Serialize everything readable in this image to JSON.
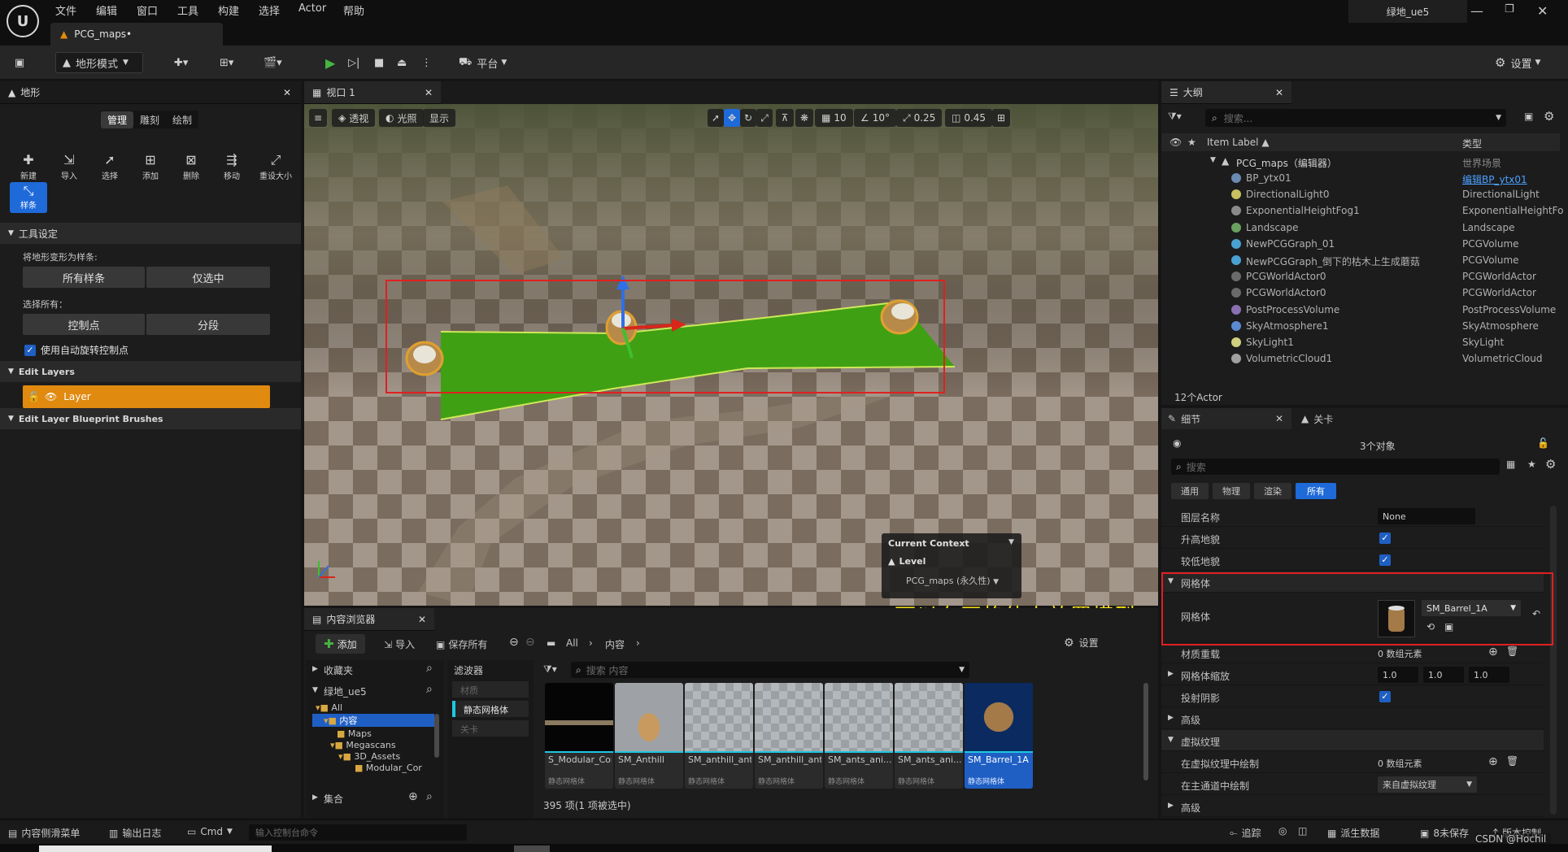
{
  "titlebar": {
    "menus": [
      "文件",
      "编辑",
      "窗口",
      "工具",
      "构建",
      "选择",
      "Actor",
      "帮助"
    ],
    "doc_tab": "PCG_maps•",
    "project": "绿地_ue5",
    "logo": "U"
  },
  "toolbar": {
    "mode": "地形模式",
    "platform": "平台",
    "settings": "设置"
  },
  "left_panel": {
    "title": "地形",
    "tabs": [
      "管理",
      "雕刻",
      "绘制"
    ],
    "tools": [
      "新建",
      "导入",
      "选择",
      "添加",
      "删除",
      "移动",
      "重设大小"
    ],
    "active_tool": "样条",
    "section_tool_settings": "工具设定",
    "deform_label": "将地形变形为样条:",
    "btn_all_splines": "所有样条",
    "btn_selected_only": "仅选中",
    "select_all_label": "选择所有：",
    "btn_control_points": "控制点",
    "btn_segments": "分段",
    "auto_rotate": "使用自动旋转控制点",
    "section_edit_layers": "Edit Layers",
    "layer_name": "Layer",
    "section_brushes": "Edit Layer Blueprint Brushes"
  },
  "viewport": {
    "tab": "视口 1",
    "perspective": "透视",
    "lighting": "光照",
    "show": "显示",
    "grid_snap": "10",
    "rot_snap": "10°",
    "scale_snap": "0.25",
    "cam_speed": "0.45",
    "context_title": "Current Context",
    "context_level": "Level",
    "context_map": "PCG_maps (永久性)",
    "annotation": "可以在网格体上放置模型"
  },
  "outline": {
    "title": "大纲",
    "search_placeholder": "搜索...",
    "col_label": "Item Label ▲",
    "col_type": "类型",
    "root": "PCG_maps（编辑器）",
    "root_type": "世界场景",
    "rows": [
      {
        "name": "BP_ytx01",
        "type": "编辑BP_ytx01"
      },
      {
        "name": "DirectionalLight0",
        "type": "DirectionalLight"
      },
      {
        "name": "ExponentialHeightFog1",
        "type": "ExponentialHeightFo"
      },
      {
        "name": "Landscape",
        "type": "Landscape"
      },
      {
        "name": "NewPCGGraph_01",
        "type": "PCGVolume"
      },
      {
        "name": "NewPCGGraph_倒下的枯木上生成蘑菇",
        "type": "PCGVolume"
      },
      {
        "name": "PCGWorldActor0",
        "type": "PCGWorldActor"
      },
      {
        "name": "PCGWorldActor0",
        "type": "PCGWorldActor"
      },
      {
        "name": "PostProcessVolume",
        "type": "PostProcessVolume"
      },
      {
        "name": "SkyAtmosphere1",
        "type": "SkyAtmosphere"
      },
      {
        "name": "SkyLight1",
        "type": "SkyLight"
      },
      {
        "name": "VolumetricCloud1",
        "type": "VolumetricCloud"
      }
    ],
    "count": "12个Actor"
  },
  "details": {
    "tab_details": "细节",
    "tab_level": "关卡",
    "objects": "3个对象",
    "search_placeholder": "搜索",
    "filters": [
      "通用",
      "物理",
      "渲染",
      "所有"
    ],
    "layer_name_label": "图层名称",
    "layer_name_value": "None",
    "raise_label": "升高地貌",
    "lower_label": "较低地貌",
    "mesh_section": "网格体",
    "mesh_label": "网格体",
    "mesh_value": "SM_Barrel_1A",
    "mat_override_label": "材质重载",
    "mat_override_value": "0 数组元素",
    "mesh_scale_label": "网格体缩放",
    "scale": [
      "1.0",
      "1.0",
      "1.0"
    ],
    "cast_shadow_label": "投射阴影",
    "advanced": "高级",
    "vt_section": "虚拟纹理",
    "vt_draw_label": "在虚拟纹理中绘制",
    "vt_draw_value": "0 数组元素",
    "main_pass_label": "在主通道中绘制",
    "main_pass_value": "来自虚拟纹理",
    "advanced2": "高级"
  },
  "content": {
    "tab": "内容浏览器",
    "add": "添加",
    "import": "导入",
    "save_all": "保存所有",
    "path_all": "All",
    "path_content": "内容",
    "settings": "设置",
    "favorites": "收藏夹",
    "project": "绿地_ue5",
    "tree": [
      "All",
      "内容",
      "Maps",
      "Megascans",
      "3D_Assets",
      "Modular_Cor"
    ],
    "collections": "集合",
    "filters_title": "滤波器",
    "filter_items": [
      "材质",
      "静态网格体",
      "关卡"
    ],
    "search_placeholder": "搜索 内容",
    "assets": [
      {
        "name": "S_Modular_Concrete_...",
        "type": "静态网格体"
      },
      {
        "name": "SM_Anthill",
        "type": "静态网格体"
      },
      {
        "name": "SM_anthill_ants_anim_line",
        "type": "静态网格体"
      },
      {
        "name": "SM_anthill_ants_anim_...",
        "type": "静态网格体"
      },
      {
        "name": "SM_ants_ani..._line",
        "type": "静态网格体"
      },
      {
        "name": "SM_ants_ani..._random",
        "type": "静态网格体"
      },
      {
        "name": "SM_Barrel_1A",
        "type": "静态网格体"
      }
    ],
    "status": "395 项(1 项被选中)"
  },
  "bottombar": {
    "drawer": "内容侧滑菜单",
    "log": "输出日志",
    "cmd": "Cmd",
    "console_placeholder": "输入控制台命令",
    "trace": "追踪",
    "derived": "派生数据",
    "unsaved": "8未保存",
    "source": "版本控制",
    "watermark": "CSDN @Hochil_"
  },
  "colors": {
    "accent": "#1f5fc4",
    "layer_orange": "#e08a10",
    "annot_yellow": "#f7e017",
    "spline_green": "#3fa014",
    "highlight_red": "#e02020"
  }
}
